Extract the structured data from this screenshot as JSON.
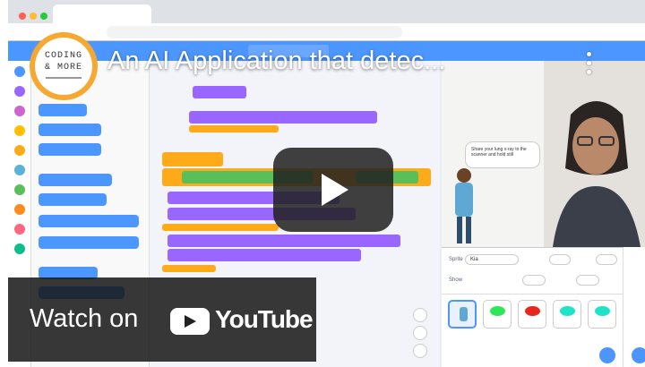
{
  "video": {
    "title": "An AI Application that detec...",
    "watch_on_label": "Watch on",
    "platform_name": "YouTube"
  },
  "channel_logo": {
    "line1": "CODING",
    "line2": "& MORE",
    "color": "#f6a830"
  },
  "sprite_bubble": {
    "text": "Share your lung x-ray to the scanner and hold still"
  },
  "sprite_info": {
    "sprite_label": "Sprite",
    "sprite_name": "Kia",
    "show_label": "Show"
  },
  "colors": {
    "scratch_blue": "#4c97ff",
    "looks_purple": "#9966ff",
    "events_yellow": "#ffab19",
    "operators_green": "#59c059",
    "youtube_overlay": "#171717"
  },
  "icons": [
    "kebab-menu-icon",
    "play-icon",
    "youtube-logo-icon",
    "zoom-in-icon",
    "zoom-out-icon",
    "zoom-reset-icon",
    "choose-sprite-icon",
    "choose-backdrop-icon"
  ]
}
